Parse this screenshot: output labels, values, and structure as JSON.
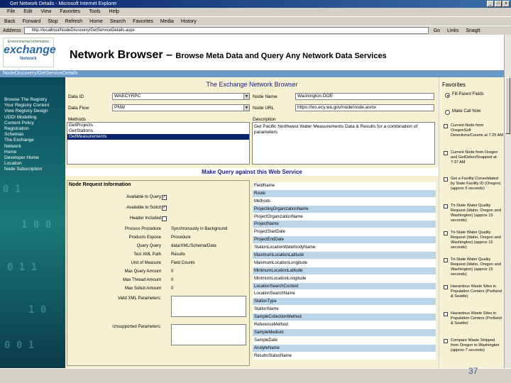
{
  "window": {
    "title": "Get Network Details - Microsoft Internet Explorer",
    "controls": [
      "_",
      "□",
      "x"
    ]
  },
  "menu": [
    "File",
    "Edit",
    "View",
    "Favorites",
    "Tools",
    "Help"
  ],
  "toolbar": [
    "Back",
    "Forward",
    "Stop",
    "Refresh",
    "Home",
    "Search",
    "Favorites",
    "Media",
    "History"
  ],
  "address": {
    "label": "Address",
    "value": "http://localhost/NodeDiscovery/GetServiceDetails.aspx",
    "go": "Go",
    "links": "Links",
    "extra": "SnagIt"
  },
  "header": {
    "logo_top": "Environmental Information",
    "logo_main": "exchange",
    "logo_sub": "Network",
    "title": "Network Browser – ",
    "subtitle": "Browse Meta Data and Query Any Network Data Services"
  },
  "breadcrumb": "NodeDiscovery/GetServiceDetails",
  "leftnav": [
    "Browse The Registry",
    "Your Registry Content",
    "View Registry Design",
    "UDDI Modelling",
    "Content Policy",
    "Registration",
    "Schemas",
    "The Exchange",
    "Network",
    "Home",
    "Developer Home",
    "Location",
    "Node Subscription"
  ],
  "main": {
    "title": "The Exchange Network Browser",
    "labels": {
      "data_id": "Data ID",
      "data_flow": "Data Flow",
      "node_name": "Node Name",
      "node_url": "Node URL",
      "methods": "Methods",
      "description": "Description"
    },
    "values": {
      "data_id": "WAECYRPC",
      "data_flow": "PNW",
      "node_name": "Washington DOE",
      "node_url": "https://ws.ecy.wa.gov/node/node.asmx"
    },
    "methods": [
      "GetProjects",
      "GetStations",
      "GetMeasurements"
    ],
    "selected_method_index": 2,
    "description_text": "Get Pacific Northwest Water Measurements Data & Results for a combination of parameters",
    "query_bar": "Make Query against this Web Service"
  },
  "params": {
    "title": "Node Request Information",
    "rows": [
      {
        "label": "Available to Query",
        "type": "checkbox",
        "value": "✓"
      },
      {
        "label": "Available to Solicit",
        "type": "checkbox",
        "value": "✓"
      },
      {
        "label": "Header Included",
        "type": "checkbox",
        "value": ""
      },
      {
        "label": "Process Procedure",
        "type": "text",
        "value": "Synchronously in Background"
      },
      {
        "label": "Products Expose",
        "type": "text",
        "value": "Procedure"
      },
      {
        "label": "Query Query",
        "type": "text",
        "value": "data/XML/Schema/Data"
      },
      {
        "label": "Test XML Path",
        "type": "text",
        "value": "Results"
      },
      {
        "label": "Unit of Measure",
        "type": "text",
        "value": "Field Counts"
      },
      {
        "label": "Max Query Amount",
        "type": "text",
        "value": "0"
      },
      {
        "label": "Max Thread Amount",
        "type": "text",
        "value": "0"
      },
      {
        "label": "Max Solicit Amount",
        "type": "text",
        "value": "0"
      }
    ],
    "valid_xml_label": "Valid XML Parameters:",
    "unsupported_label": "Unsupported Parameters:"
  },
  "field_list": [
    "FieldName",
    "Route",
    "Methods",
    "ProjectingOrganizationName",
    "ProjectOrganizationName",
    "ProjectName",
    "ProjectStartDate",
    "ProjectEndDate",
    "StationLocationWaterbodyName",
    "MaximumLocationLatitude",
    "MaximumLocationLongitude",
    "MinimumLocationLatitude",
    "MinimumLocationLongitude",
    "LocationSearchContext",
    "LocationSearchName",
    "StationType",
    "StationName",
    "SampleCollectionMethod",
    "ReferenceMethod",
    "SampleMedium",
    "SampleDate",
    "AnalyteName",
    "ResultsStatusName"
  ],
  "favorites": {
    "title": "Favorites",
    "radios": [
      {
        "label": "Fill Parent Fields",
        "on": true
      },
      {
        "label": "Make Call Now",
        "on": false
      }
    ],
    "items": [
      "Current Node from OregonSoft Detections/Counts at 7:25 AM",
      "Current Node from Oregon and GetDetectSnapped at 7:37 AM",
      "Get a Facility Consolidated by State Facility ID (Oregon) (approx 5 seconds)",
      "Tri-State Water Quality Request (Idaho, Oregon and Washington) (approx 15 seconds)",
      "Tri-State Water Quality Request (Idaho, Oregon and Washington) (approx 15 seconds)",
      "Tri-State Water Quality Request (Idaho, Oregon and Washington) (approx 15 seconds)",
      "Hazardous Waste Sites in Population Centers (Portland & Seattle)",
      "Hazardous Waste Sites in Population Centers (Portland & Seattle)",
      "Compare Waste Shipped from Oregon to Washington (approx 7 seconds)"
    ]
  },
  "slide_number": "37"
}
